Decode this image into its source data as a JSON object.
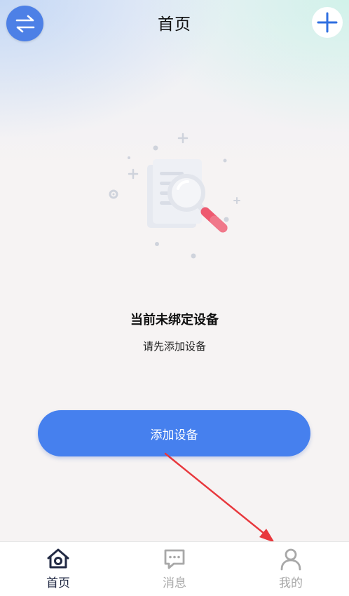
{
  "header": {
    "title": "首页",
    "left_icon": "switch-arrows-icon",
    "right_icon": "plus-icon"
  },
  "empty_state": {
    "illustration_icon": "document-search-icon",
    "title": "当前未绑定设备",
    "subtitle": "请先添加设备"
  },
  "primary_action": {
    "label": "添加设备"
  },
  "tabbar": {
    "tabs": [
      {
        "label": "首页",
        "icon": "home-icon",
        "active": true
      },
      {
        "label": "消息",
        "icon": "message-icon",
        "active": false
      },
      {
        "label": "我的",
        "icon": "user-icon",
        "active": false
      }
    ]
  },
  "colors": {
    "accent": "#4680ee",
    "annotation_arrow": "#e8383d",
    "tab_active": "#222a44",
    "tab_inactive": "#a8a8a8"
  }
}
